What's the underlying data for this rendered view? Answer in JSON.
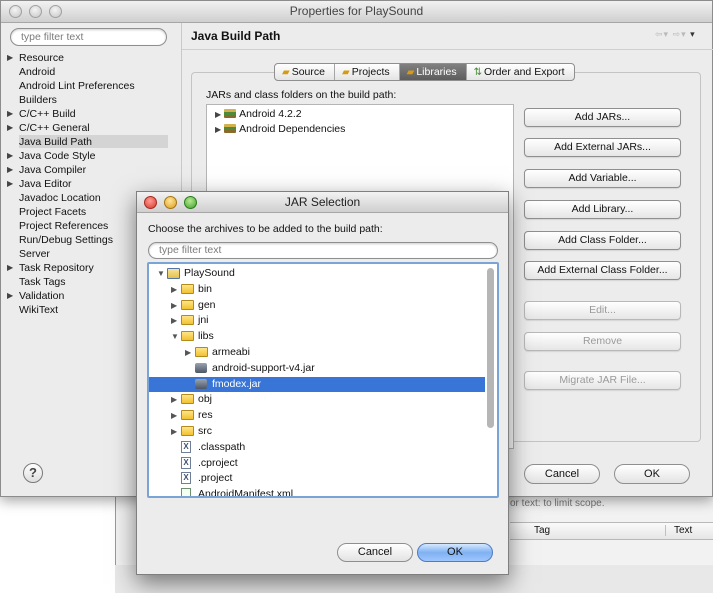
{
  "window": {
    "title": "Properties for PlaySound",
    "filter_placeholder": "type filter text",
    "section_title": "Java Build Path"
  },
  "nav": {
    "items": [
      {
        "label": "Resource",
        "expandable": true
      },
      {
        "label": "Android",
        "expandable": false
      },
      {
        "label": "Android Lint Preferences",
        "expandable": false
      },
      {
        "label": "Builders",
        "expandable": false
      },
      {
        "label": "C/C++ Build",
        "expandable": true
      },
      {
        "label": "C/C++ General",
        "expandable": true
      },
      {
        "label": "Java Build Path",
        "expandable": false,
        "selected": true
      },
      {
        "label": "Java Code Style",
        "expandable": true
      },
      {
        "label": "Java Compiler",
        "expandable": true
      },
      {
        "label": "Java Editor",
        "expandable": true
      },
      {
        "label": "Javadoc Location",
        "expandable": false
      },
      {
        "label": "Project Facets",
        "expandable": false
      },
      {
        "label": "Project References",
        "expandable": false
      },
      {
        "label": "Run/Debug Settings",
        "expandable": false
      },
      {
        "label": "Server",
        "expandable": false
      },
      {
        "label": "Task Repository",
        "expandable": true
      },
      {
        "label": "Task Tags",
        "expandable": false
      },
      {
        "label": "Validation",
        "expandable": true
      },
      {
        "label": "WikiText",
        "expandable": false
      }
    ]
  },
  "tabs": [
    {
      "label": "Source",
      "active": false
    },
    {
      "label": "Projects",
      "active": false
    },
    {
      "label": "Libraries",
      "active": true
    },
    {
      "label": "Order and Export",
      "active": false
    }
  ],
  "libraries": {
    "label": "JARs and class folders on the build path:",
    "entries": [
      "Android 4.2.2",
      "Android Dependencies"
    ]
  },
  "side_buttons": [
    {
      "label": "Add JARs...",
      "enabled": true
    },
    {
      "label": "Add External JARs...",
      "enabled": true
    },
    {
      "label": "Add Variable...",
      "enabled": true
    },
    {
      "label": "Add Library...",
      "enabled": true
    },
    {
      "label": "Add Class Folder...",
      "enabled": true
    },
    {
      "label": "Add External Class Folder...",
      "enabled": true
    },
    {
      "label": "Edit...",
      "enabled": false
    },
    {
      "label": "Remove",
      "enabled": false
    },
    {
      "label": "Migrate JAR File...",
      "enabled": false
    }
  ],
  "bottom": {
    "help": "?",
    "cancel": "Cancel",
    "ok": "OK"
  },
  "background": {
    "filter_hint": "or text: to limit scope.",
    "col_tag": "Tag",
    "col_text": "Text"
  },
  "dialog": {
    "title": "JAR Selection",
    "prompt": "Choose the archives to be added to the build path:",
    "filter_placeholder": "type filter text",
    "tree": [
      {
        "label": "PlaySound",
        "type": "project",
        "depth": 0,
        "twisty": "open"
      },
      {
        "label": "bin",
        "type": "folder",
        "depth": 1,
        "twisty": "closed"
      },
      {
        "label": "gen",
        "type": "folder",
        "depth": 1,
        "twisty": "closed"
      },
      {
        "label": "jni",
        "type": "folder",
        "depth": 1,
        "twisty": "closed"
      },
      {
        "label": "libs",
        "type": "folder",
        "depth": 1,
        "twisty": "open"
      },
      {
        "label": "armeabi",
        "type": "folder",
        "depth": 2,
        "twisty": "closed"
      },
      {
        "label": "android-support-v4.jar",
        "type": "jar",
        "depth": 2,
        "twisty": "none"
      },
      {
        "label": "fmodex.jar",
        "type": "jar",
        "depth": 2,
        "twisty": "none",
        "selected": true
      },
      {
        "label": "obj",
        "type": "folder",
        "depth": 1,
        "twisty": "closed"
      },
      {
        "label": "res",
        "type": "folder",
        "depth": 1,
        "twisty": "closed"
      },
      {
        "label": "src",
        "type": "folder",
        "depth": 1,
        "twisty": "closed"
      },
      {
        "label": ".classpath",
        "type": "file",
        "depth": 1,
        "twisty": "none"
      },
      {
        "label": ".cproject",
        "type": "file",
        "depth": 1,
        "twisty": "none"
      },
      {
        "label": ".project",
        "type": "file",
        "depth": 1,
        "twisty": "none"
      },
      {
        "label": "AndroidManifest.xml",
        "type": "xml",
        "depth": 1,
        "twisty": "none"
      }
    ],
    "cancel": "Cancel",
    "ok": "OK"
  }
}
